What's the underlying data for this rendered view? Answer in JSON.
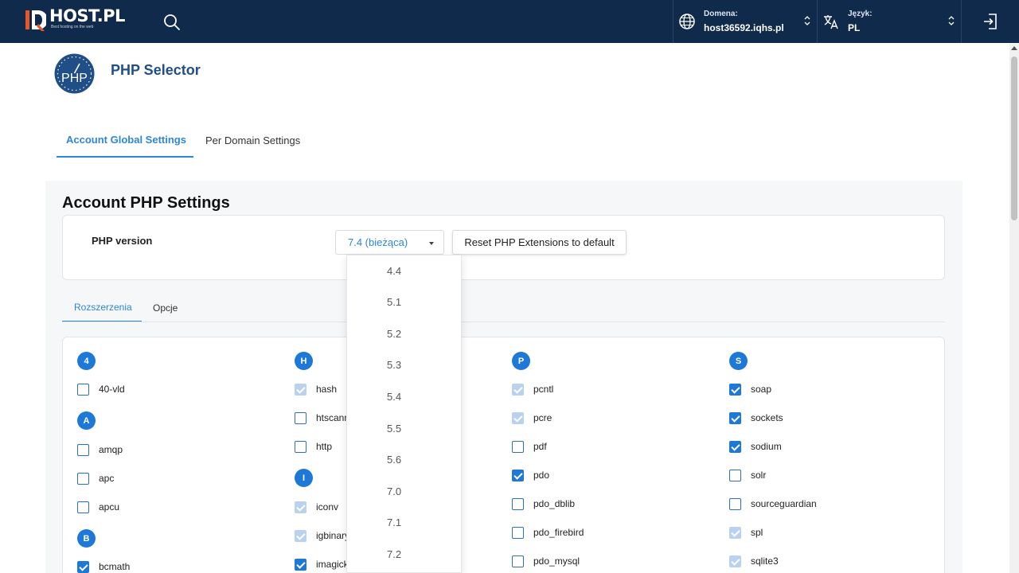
{
  "topbar": {
    "logo_name": "HOST.PL",
    "logo_tagline": "Best hosting on the web",
    "domain_label": "Domena:",
    "domain_value": "host36592.iqhs.pl",
    "language_label": "Język:",
    "language_value": "PL"
  },
  "header": {
    "php_logo_text": "PHP",
    "title": "PHP Selector"
  },
  "tabs": {
    "global": "Account Global Settings",
    "domain": "Per Domain Settings"
  },
  "settings": {
    "section_title": "Account PHP Settings",
    "php_version_label": "PHP version",
    "php_version_value": "7.4 (bieżąca)",
    "reset_button": "Reset PHP Extensions to default"
  },
  "subtabs": {
    "extensions": "Rozszerzenia",
    "options": "Opcje"
  },
  "version_options": [
    "4.4",
    "5.1",
    "5.2",
    "5.3",
    "5.4",
    "5.5",
    "5.6",
    "7.0",
    "7.1",
    "7.2"
  ],
  "extensions": {
    "col1": {
      "letters": [
        "4",
        "A",
        "B"
      ],
      "items": [
        {
          "name": "40-vld",
          "state": "off"
        },
        {
          "name": "amqp",
          "state": "off"
        },
        {
          "name": "apc",
          "state": "off"
        },
        {
          "name": "apcu",
          "state": "off"
        },
        {
          "name": "bcmath",
          "state": "on"
        }
      ]
    },
    "col2": {
      "letters": [
        "H",
        "I"
      ],
      "items": [
        {
          "name": "hash",
          "state": "disabled"
        },
        {
          "name": "htscanner",
          "state": "off"
        },
        {
          "name": "http",
          "state": "off"
        },
        {
          "name": "iconv",
          "state": "disabled"
        },
        {
          "name": "igbinary",
          "state": "disabled"
        },
        {
          "name": "imagick",
          "state": "on"
        }
      ]
    },
    "col3": {
      "letters": [
        "P"
      ],
      "items": [
        {
          "name": "pcntl",
          "state": "disabled"
        },
        {
          "name": "pcre",
          "state": "disabled"
        },
        {
          "name": "pdf",
          "state": "off"
        },
        {
          "name": "pdo",
          "state": "on"
        },
        {
          "name": "pdo_dblib",
          "state": "off"
        },
        {
          "name": "pdo_firebird",
          "state": "off"
        },
        {
          "name": "pdo_mysql",
          "state": "off"
        }
      ]
    },
    "col4": {
      "letters": [
        "S"
      ],
      "items": [
        {
          "name": "soap",
          "state": "on"
        },
        {
          "name": "sockets",
          "state": "on"
        },
        {
          "name": "sodium",
          "state": "on"
        },
        {
          "name": "solr",
          "state": "off"
        },
        {
          "name": "sourceguardian",
          "state": "off"
        },
        {
          "name": "spl",
          "state": "disabled"
        },
        {
          "name": "sqlite3",
          "state": "disabled"
        }
      ]
    }
  },
  "colors": {
    "topbar": "#102a4c",
    "accent": "#2e86d8",
    "title": "#1f4f86",
    "checkbox_on": "#1e78d7",
    "checkbox_disabled": "#b9d2ef"
  }
}
